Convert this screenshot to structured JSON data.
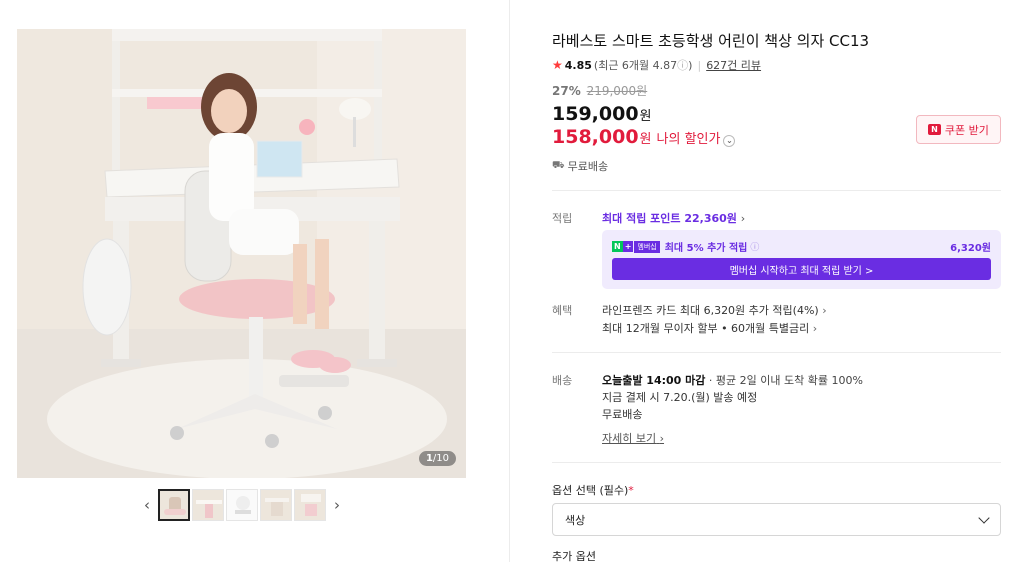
{
  "gallery": {
    "counter_current": "1",
    "counter_total": "/10",
    "prev_icon": "chevron-left-icon",
    "next_icon": "chevron-right-icon",
    "thumbnail_count": 5
  },
  "product": {
    "title": "라베스토 스마트 초등학생 어린이 책상 의자 CC13",
    "rating": {
      "score": "4.85",
      "recent": "(최근 6개월 4.87",
      "recent_suffix": ")",
      "reviews": "627건 리뷰"
    },
    "discount_rate": "27%",
    "original_price": "219,000원",
    "price": "159,000",
    "price_unit": "원",
    "my_price": "158,000",
    "my_price_unit": "원",
    "my_price_label": "나의 할인가",
    "coupon_label": "쿠폰 받기",
    "coupon_badge": "N",
    "free_shipping": "무료배송"
  },
  "accumulate": {
    "label": "적립",
    "link": "최대 적립 포인트 22,360원",
    "member": {
      "badge_n": "N",
      "badge_plus": "+",
      "badge_membership": "멤버십",
      "text": "최대 5% 추가 적립",
      "amount": "6,320원",
      "button": "멤버십 시작하고 최대 적립 받기 >"
    }
  },
  "benefit": {
    "label": "혜택",
    "line1": "라인프렌즈 카드 최대 6,320원 추가 적립(4%)",
    "line2": "최대 12개월 무이자 할부 • 60개월 특별금리"
  },
  "delivery": {
    "label": "배송",
    "deadline": "오늘출발 14:00 마감",
    "stats": "· 평균 2일 이내 도착 확률 100%",
    "line2": "지금 결제 시 7.20.(월) 발송 예정",
    "line3": "무료배송",
    "detail_link": "자세히 보기"
  },
  "options": {
    "label": "옵션 선택 (필수)",
    "required_mark": "*",
    "select_value": "색상",
    "extra_label": "추가 옵션"
  },
  "colors": {
    "price_red": "#e11b3c",
    "naver_purple": "#6a2de2",
    "naver_green": "#03c75a",
    "star": "#ff3b3b"
  }
}
